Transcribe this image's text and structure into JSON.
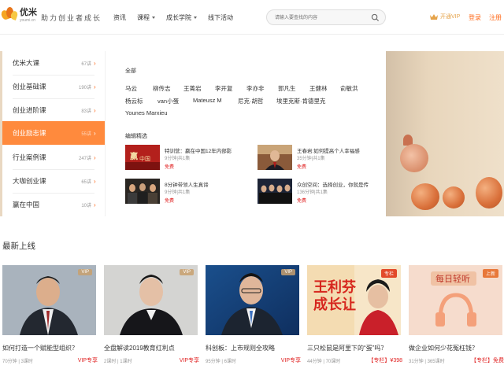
{
  "header": {
    "logo_name": "优米",
    "logo_sub": "youmi.cn",
    "slogan": "助力创业者成长",
    "nav": [
      {
        "label": "资讯",
        "has_caret": false
      },
      {
        "label": "课程",
        "has_caret": true
      },
      {
        "label": "成长学院",
        "has_caret": true
      },
      {
        "label": "线下活动",
        "has_caret": false
      }
    ],
    "search_placeholder": "请输入要查找的内容",
    "vip_label": "开通VIP",
    "login_label": "登录",
    "register_label": "注册"
  },
  "category_menu": [
    {
      "label": "优米大课",
      "count": "67讲",
      "active": false
    },
    {
      "label": "创业基础课",
      "count": "190讲",
      "active": false
    },
    {
      "label": "创业进阶课",
      "count": "83讲",
      "active": false
    },
    {
      "label": "创业励志课",
      "count": "55讲",
      "active": true
    },
    {
      "label": "行业案例课",
      "count": "247讲",
      "active": false
    },
    {
      "label": "大咖创业课",
      "count": "65讲",
      "active": false
    },
    {
      "label": "赢在中国",
      "count": "10讲",
      "active": false
    }
  ],
  "mega_panel": {
    "all_heading": "全部",
    "teachers": [
      "马云",
      "柳传志",
      "王菁岩",
      "李开复",
      "李亦非",
      "郭凡生",
      "王健林",
      "俞敏洪",
      "杨云标",
      "van小蛋",
      "Mateusz M",
      "尼克·胡哲",
      "埃里克斯·肯德里克",
      "Younes Marxieu"
    ],
    "picks_heading": "编辑精选",
    "picks": [
      {
        "title": "特训营：赢在中国12年内部影",
        "meta": "9分钟|共1集",
        "price": "免费"
      },
      {
        "title": "王春岩:如何提高个人幸福感",
        "meta": "35分钟|共1集",
        "price": "免费"
      },
      {
        "title": "8分钟带领人生真谛",
        "meta": "9分钟|共1集",
        "price": "免费"
      },
      {
        "title": "众创空间：选择创业，你就是传",
        "meta": "136分钟|共1集",
        "price": "免费"
      }
    ]
  },
  "latest": {
    "title": "最新上线",
    "cards": [
      {
        "title": "如何打造一个赋能型组织？",
        "meta": "70分钟 | 3课时",
        "tag": "VIP专享",
        "badge": "VIP",
        "badge_type": "vip"
      },
      {
        "title": "全盘解读2019教育红利点",
        "meta": "2课时 | 1课时",
        "tag": "VIP专享",
        "badge": "VIP",
        "badge_type": "vip"
      },
      {
        "title": "科创板：上市规则全攻略",
        "meta": "95分钟 | 6课时",
        "tag": "VIP专享",
        "badge": "VIP",
        "badge_type": "vip"
      },
      {
        "title": "三只松鼠是阿里下的“蛋”吗？",
        "meta": "44分钟 | 70课时",
        "tag": "【专栏】¥398",
        "badge": "专栏",
        "badge_type": "col"
      },
      {
        "title": "做企业如何少花冤枉钱？",
        "meta": "31分钟 | 365课时",
        "tag": "【专栏】免费",
        "badge": "上新",
        "badge_type": "onl"
      }
    ],
    "card3_overlay_line1": "王利芬",
    "card3_overlay_line2": "成长让",
    "card4_overlay": "每日轻听"
  }
}
